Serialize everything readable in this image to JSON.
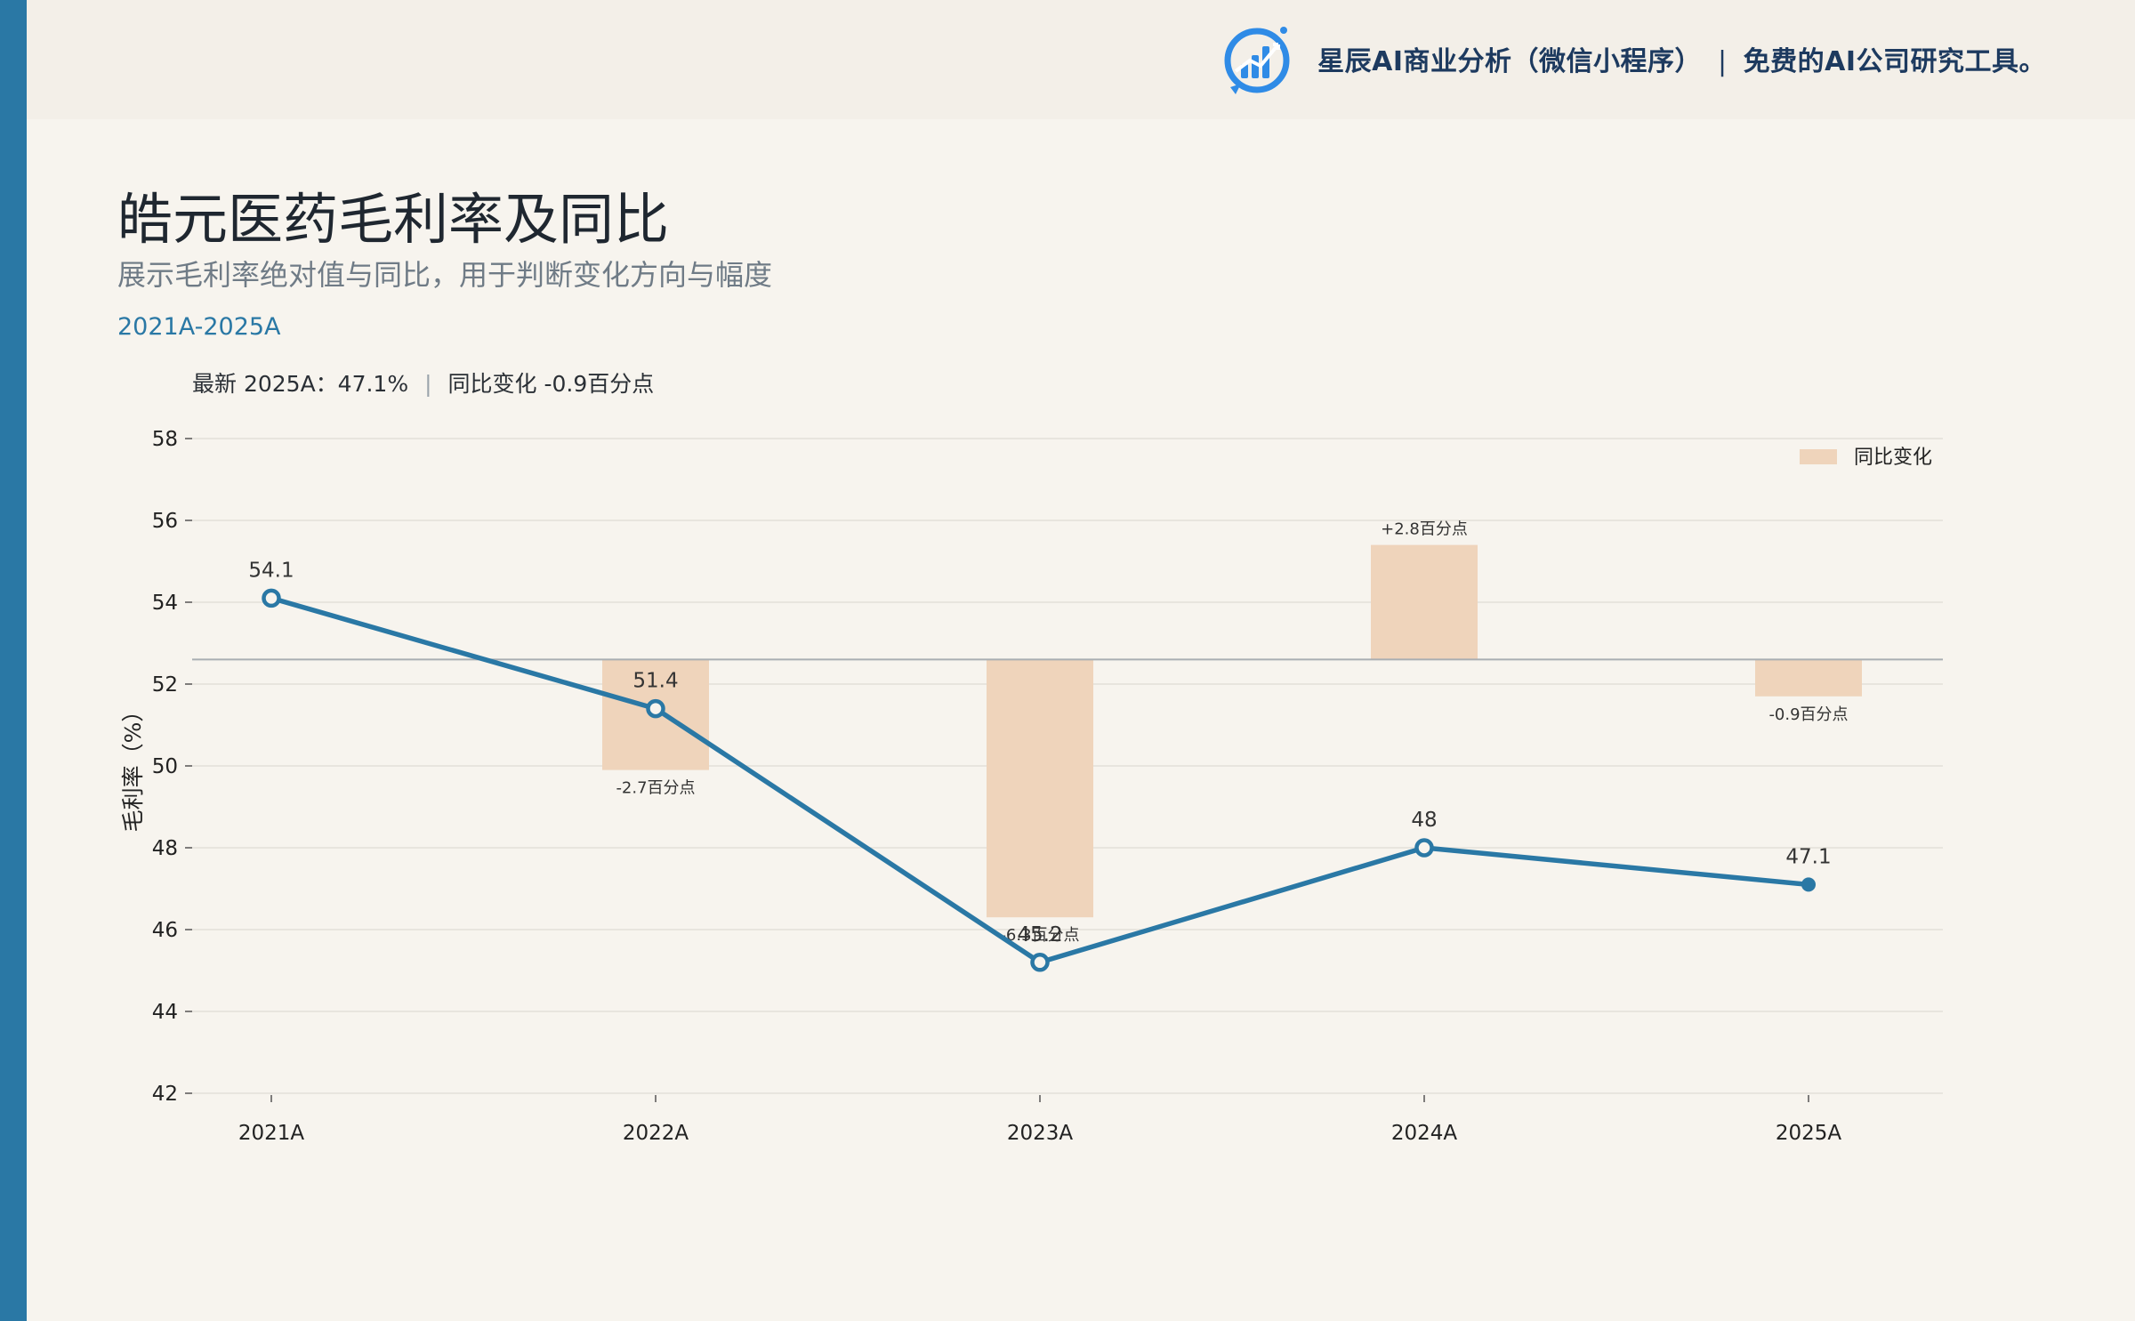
{
  "header": {
    "brand_name": "星辰AI商业分析（微信小程序）",
    "separator": "|",
    "tagline": "免费的AI公司研究工具。"
  },
  "page": {
    "title": "皓元医药毛利率及同比",
    "subtitle": "展示毛利率绝对值与同比，用于判断变化方向与幅度",
    "period": "2021A-2025A"
  },
  "summary": {
    "latest": "最新 2025A：47.1%",
    "divider": "|",
    "change": "同比变化 -0.9百分点"
  },
  "colors": {
    "line": "#2a78a5",
    "bar": "#efd4bb",
    "accent": "#2a78a5"
  },
  "chart_data": {
    "type": "line",
    "categories": [
      "2021A",
      "2022A",
      "2023A",
      "2024A",
      "2025A"
    ],
    "ylabel": "毛利率（%）",
    "ylim": [
      42,
      58
    ],
    "yticks": [
      42,
      44,
      46,
      48,
      50,
      52,
      54,
      56,
      58
    ],
    "grid": true,
    "legend_position": "top-right",
    "series": [
      {
        "values": [
          54.1,
          51.4,
          45.2,
          48,
          47.1
        ],
        "labels": [
          "54.1",
          "51.4",
          "45.2",
          "48",
          "47.1"
        ]
      },
      {
        "name": "同比变化",
        "type": "bar",
        "values": [
          null,
          -2.7,
          -6.3,
          2.8,
          -0.9
        ],
        "labels": [
          "",
          "-2.7百分点",
          "-6.3百分点",
          "+2.8百分点",
          "-0.9百分点"
        ]
      }
    ]
  }
}
